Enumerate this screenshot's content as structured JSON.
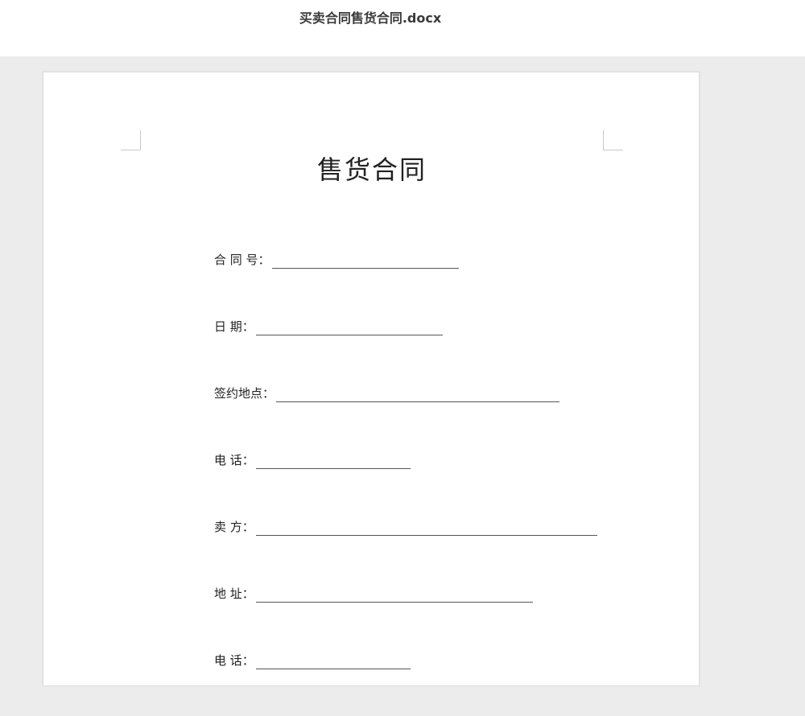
{
  "window": {
    "title": "买卖合同售货合同.docx"
  },
  "document": {
    "heading": "售货合同",
    "fields": [
      {
        "label": "合 同 号："
      },
      {
        "label": "日 期："
      },
      {
        "label": "签约地点："
      },
      {
        "label": "电 话："
      },
      {
        "label": "卖 方："
      },
      {
        "label": "地 址："
      },
      {
        "label": "电 话："
      }
    ]
  }
}
